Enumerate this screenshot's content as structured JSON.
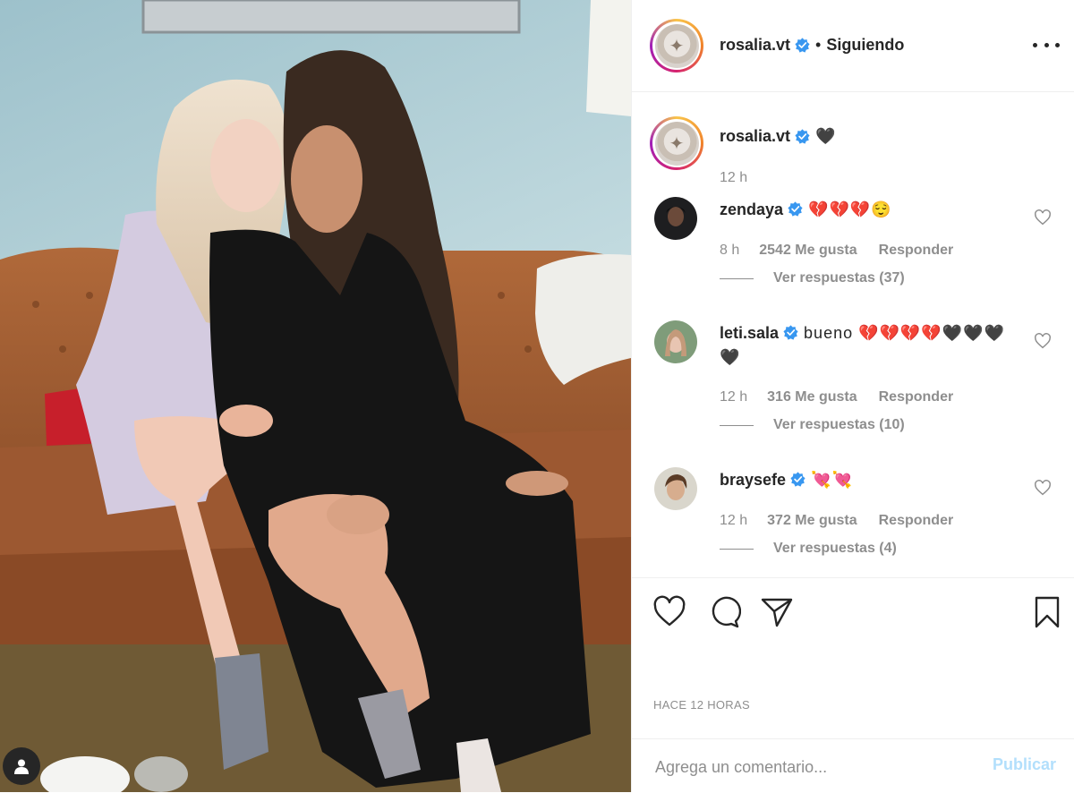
{
  "post": {
    "author": "rosalia.vt",
    "follow_separator": "•",
    "follow_status": "Siguiendo",
    "caption_text": "🖤",
    "caption_time": "12 h",
    "timestamp": "HACE 12 HORAS"
  },
  "comments": [
    {
      "user": "zendaya",
      "text": "💔💔💔😌",
      "time": "8 h",
      "likes": "2542 Me gusta",
      "reply": "Responder",
      "replies": "Ver respuestas (37)"
    },
    {
      "user": "leti.sala",
      "text": "bueno 💔💔💔💔🖤🖤🖤🖤",
      "time": "12 h",
      "likes": "316 Me gusta",
      "reply": "Responder",
      "replies": "Ver respuestas (10)"
    },
    {
      "user": "braysefe",
      "text": "💘💘",
      "time": "12 h",
      "likes": "372 Me gusta",
      "reply": "Responder",
      "replies": "Ver respuestas (4)"
    }
  ],
  "comment_box": {
    "placeholder": "Agrega un comentario...",
    "publish_label": "Publicar"
  },
  "colors": {
    "verified": "#3897f0",
    "publish_disabled": "#b2dffc",
    "secondary_text": "#8e8e8e"
  },
  "icons": [
    "user-tag-icon",
    "more-options-icon",
    "verified-icon",
    "heart-icon",
    "comment-icon",
    "share-icon",
    "bookmark-icon"
  ]
}
